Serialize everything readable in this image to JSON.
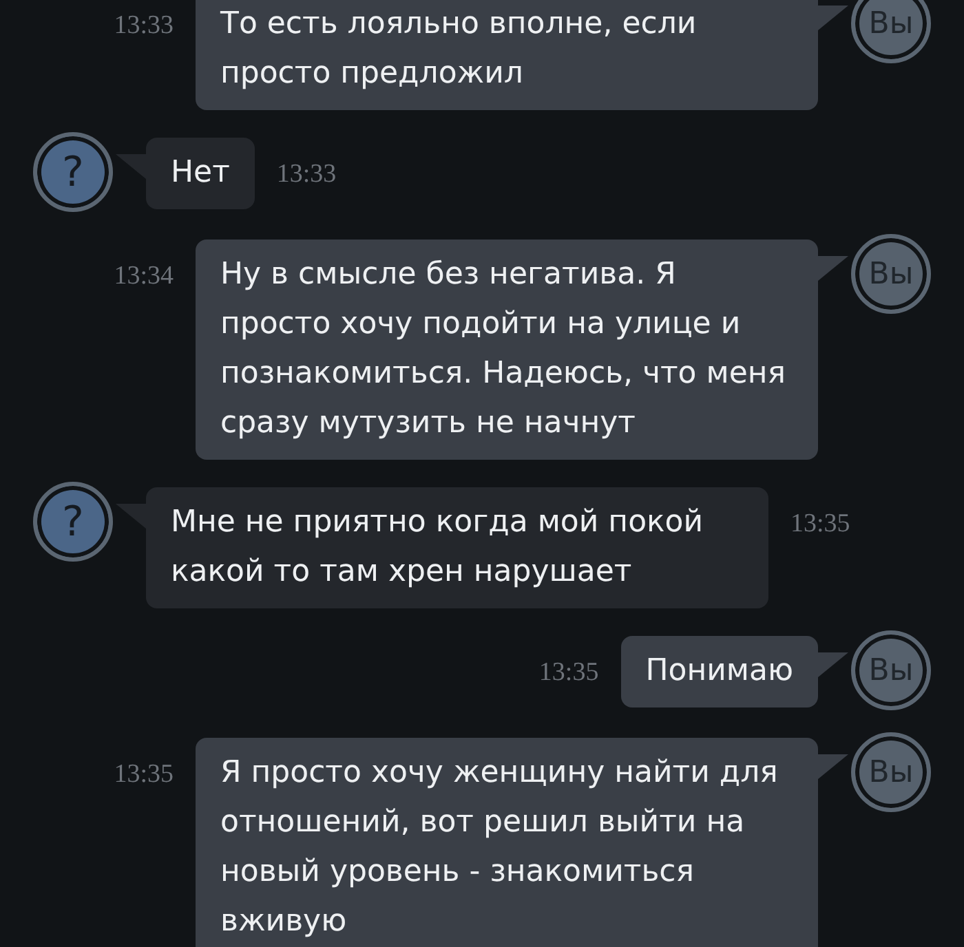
{
  "messages": [
    {
      "kind": "out",
      "avatar": "Вы",
      "time": "13:33",
      "text": "То есть лояльно вполне, если просто предложил"
    },
    {
      "kind": "in",
      "avatar": "?",
      "time": "13:33",
      "text": "Нет"
    },
    {
      "kind": "out",
      "avatar": "Вы",
      "time": "13:34",
      "text": "Ну в смысле без негатива. Я просто хочу подойти на улице и познакомиться. Надеюсь, что меня сразу мутузить не начнут"
    },
    {
      "kind": "in",
      "avatar": "?",
      "time": "13:35",
      "text": "Мне не приятно когда мой покой какой то там хрен нарушает"
    },
    {
      "kind": "out",
      "avatar": "Вы",
      "time": "13:35",
      "text": "Понимаю"
    },
    {
      "kind": "out",
      "avatar": "Вы",
      "time": "13:35",
      "text": "Я просто хочу женщину найти для отношений, вот решил выйти на новый уровень - знакомиться вживую"
    }
  ]
}
